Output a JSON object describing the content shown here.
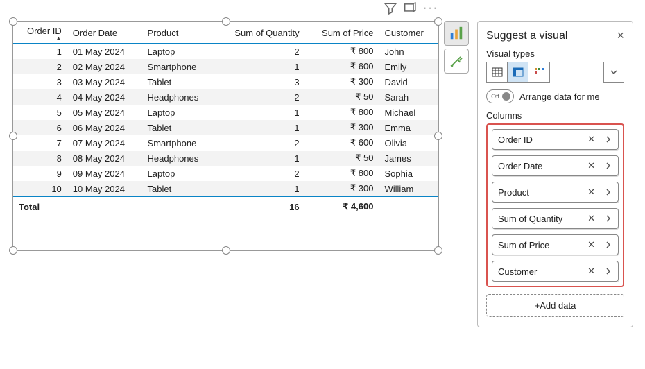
{
  "table": {
    "columns": [
      "Order ID",
      "Order Date",
      "Product",
      "Sum of Quantity",
      "Sum of Price",
      "Customer"
    ],
    "col_align": [
      "num",
      "",
      "",
      "num",
      "num",
      ""
    ],
    "rows": [
      {
        "id": "1",
        "date": "01 May 2024",
        "product": "Laptop",
        "qty": "2",
        "price": "₹ 800",
        "customer": "John"
      },
      {
        "id": "2",
        "date": "02 May 2024",
        "product": "Smartphone",
        "qty": "1",
        "price": "₹ 600",
        "customer": "Emily"
      },
      {
        "id": "3",
        "date": "03 May 2024",
        "product": "Tablet",
        "qty": "3",
        "price": "₹ 300",
        "customer": "David"
      },
      {
        "id": "4",
        "date": "04 May 2024",
        "product": "Headphones",
        "qty": "2",
        "price": "₹ 50",
        "customer": "Sarah"
      },
      {
        "id": "5",
        "date": "05 May 2024",
        "product": "Laptop",
        "qty": "1",
        "price": "₹ 800",
        "customer": "Michael"
      },
      {
        "id": "6",
        "date": "06 May 2024",
        "product": "Tablet",
        "qty": "1",
        "price": "₹ 300",
        "customer": "Emma"
      },
      {
        "id": "7",
        "date": "07 May 2024",
        "product": "Smartphone",
        "qty": "2",
        "price": "₹ 600",
        "customer": "Olivia"
      },
      {
        "id": "8",
        "date": "08 May 2024",
        "product": "Headphones",
        "qty": "1",
        "price": "₹ 50",
        "customer": "James"
      },
      {
        "id": "9",
        "date": "09 May 2024",
        "product": "Laptop",
        "qty": "2",
        "price": "₹ 800",
        "customer": "Sophia"
      },
      {
        "id": "10",
        "date": "10 May 2024",
        "product": "Tablet",
        "qty": "1",
        "price": "₹ 300",
        "customer": "William"
      }
    ],
    "total_label": "Total",
    "total_qty": "16",
    "total_price": "₹ 4,600"
  },
  "panel": {
    "title": "Suggest a visual",
    "visual_types_label": "Visual types",
    "arrange_label": "Arrange data for me",
    "toggle_text": "Off",
    "columns_label": "Columns",
    "columns": [
      "Order ID",
      "Order Date",
      "Product",
      "Sum of Quantity",
      "Sum of Price",
      "Customer"
    ],
    "add_data_label": "+Add data"
  }
}
